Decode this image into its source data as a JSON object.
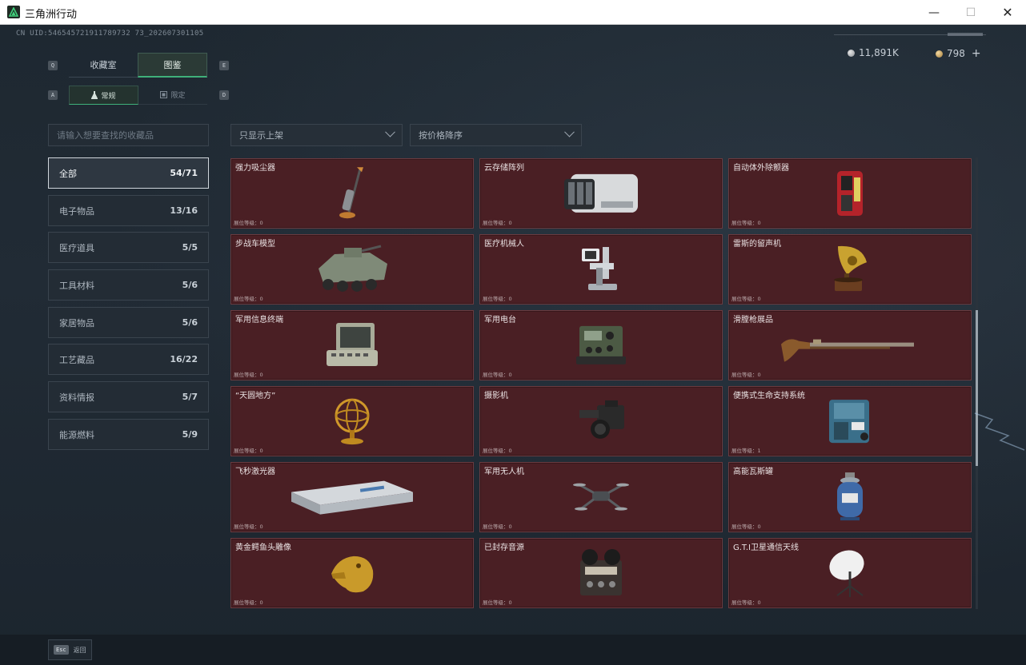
{
  "window": {
    "title": "三角洲行动",
    "minimize": "—",
    "maximize": "☐",
    "close": "✕"
  },
  "header": {
    "uid": "CN UID:546545721911789732 73_202607301105",
    "currency_silver": "11,891K",
    "currency_gold": "798",
    "currency_add": "+"
  },
  "keyhints": {
    "q": "Q",
    "e": "E",
    "a": "A",
    "d": "D"
  },
  "tabs": {
    "collection": "收藏室",
    "atlas": "图鉴"
  },
  "subtabs": {
    "normal": "常规",
    "limited": "限定"
  },
  "search": {
    "placeholder": "请输入想要查找的收藏品"
  },
  "filters": {
    "shelf": "只显示上架",
    "sort": "按价格降序"
  },
  "categories": [
    {
      "label": "全部",
      "count": "54/71",
      "active": true
    },
    {
      "label": "电子物品",
      "count": "13/16"
    },
    {
      "label": "医疗道具",
      "count": "5/5"
    },
    {
      "label": "工具材料",
      "count": "5/6"
    },
    {
      "label": "家居物品",
      "count": "5/6"
    },
    {
      "label": "工艺藏品",
      "count": "16/22"
    },
    {
      "label": "资料情报",
      "count": "5/7"
    },
    {
      "label": "能源燃料",
      "count": "5/9"
    }
  ],
  "items": [
    {
      "name": "强力吸尘器",
      "level": "展位等级：0",
      "icon": "vacuum-icon"
    },
    {
      "name": "云存储阵列",
      "level": "展位等级：0",
      "icon": "storage-array-icon"
    },
    {
      "name": "自动体外除颤器",
      "level": "展位等级：0",
      "icon": "defibrillator-icon"
    },
    {
      "name": "步战车模型",
      "level": "展位等级：0",
      "icon": "ifv-model-icon"
    },
    {
      "name": "医疗机械人",
      "level": "展位等级：0",
      "icon": "medical-robot-icon"
    },
    {
      "name": "雷斯的留声机",
      "level": "展位等级：0",
      "icon": "gramophone-icon"
    },
    {
      "name": "军用信息终端",
      "level": "展位等级：0",
      "icon": "info-terminal-icon"
    },
    {
      "name": "军用电台",
      "level": "展位等级：0",
      "icon": "radio-icon"
    },
    {
      "name": "滑膛枪展品",
      "level": "展位等级：0",
      "icon": "musket-icon"
    },
    {
      "name": "“天圆地方”",
      "level": "展位等级：0",
      "icon": "armillary-icon"
    },
    {
      "name": "摄影机",
      "level": "展位等级：0",
      "icon": "camera-icon"
    },
    {
      "name": "便携式生命支持系统",
      "level": "展位等级：1",
      "icon": "life-support-icon"
    },
    {
      "name": "飞秒激光器",
      "level": "展位等级：0",
      "icon": "laser-icon"
    },
    {
      "name": "军用无人机",
      "level": "展位等级：0",
      "icon": "drone-icon"
    },
    {
      "name": "高能瓦斯罐",
      "level": "展位等级：0",
      "icon": "gas-tank-icon"
    },
    {
      "name": "黄金鳄鱼头雕像",
      "level": "展位等级：0",
      "icon": "gold-croc-icon"
    },
    {
      "name": "已封存音源",
      "level": "展位等级：0",
      "icon": "reel-recorder-icon"
    },
    {
      "name": "G.T.I卫星通信天线",
      "level": "展位等级：0",
      "icon": "satellite-dish-icon"
    }
  ],
  "bottom": {
    "esc_key": "Esc",
    "esc_label": "返回"
  },
  "colors": {
    "card_bg": "#4a1f24",
    "accent_green": "#3fb07a",
    "background": "#1e2831"
  }
}
